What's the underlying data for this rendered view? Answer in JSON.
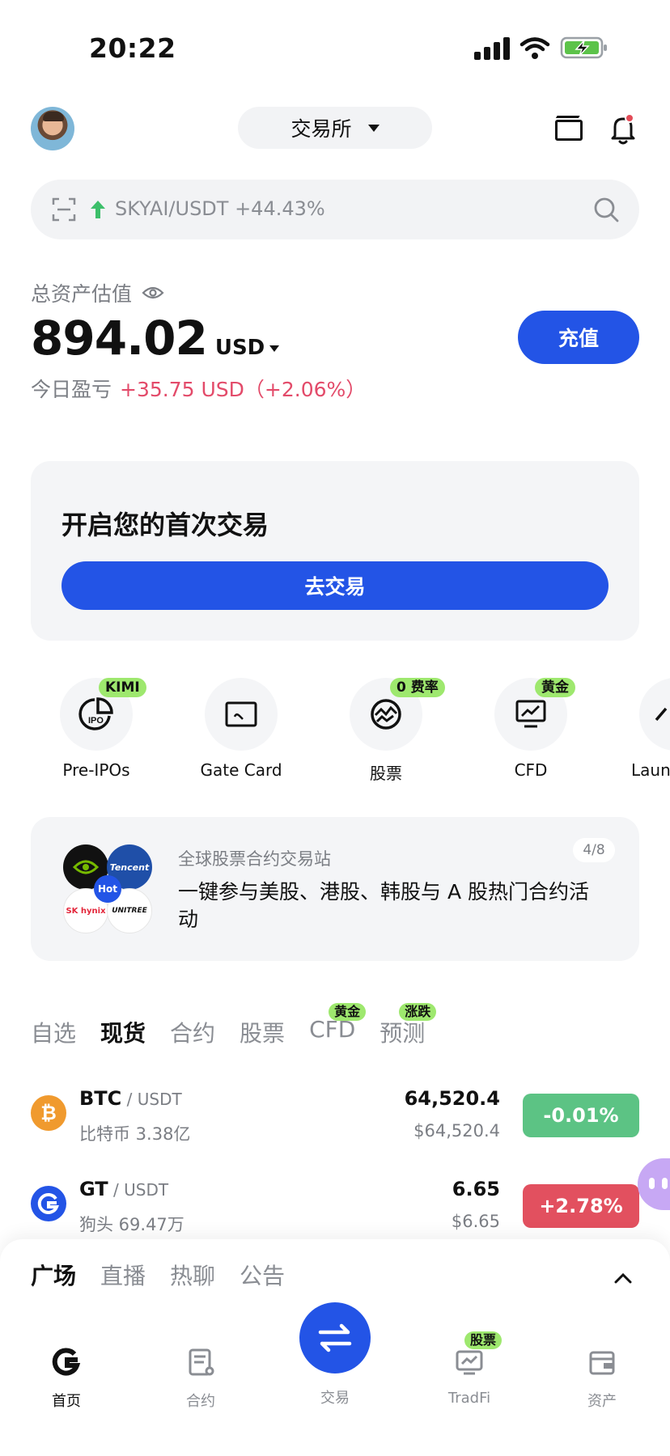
{
  "status_bar": {
    "time": "20:22"
  },
  "header": {
    "exchange_label": "交易所"
  },
  "search": {
    "trend_text": "SKYAI/USDT +44.43%"
  },
  "assets": {
    "label": "总资产估值",
    "value": "894.02",
    "currency": "USD",
    "deposit_label": "充值",
    "pnl_label": "今日盈亏",
    "pnl_value": "+35.75 USD（+2.06%）"
  },
  "first_trade": {
    "title": "开启您的首次交易",
    "button_label": "去交易"
  },
  "shortcuts": [
    {
      "label": "Pre-IPOs",
      "badge": "KIMI",
      "icon": "pre-ipo-icon"
    },
    {
      "label": "Gate Card",
      "badge": "",
      "icon": "card-icon"
    },
    {
      "label": "股票",
      "badge": "0 费率",
      "icon": "globe-stock-icon"
    },
    {
      "label": "CFD",
      "badge": "黄金",
      "icon": "chart-monitor-icon"
    },
    {
      "label": "Launc",
      "badge": "",
      "icon": "launch-icon"
    }
  ],
  "promo": {
    "kicker": "全球股票合约交易站",
    "title": "一键参与美股、港股、韩股与 A 股热门合约活动",
    "counter": "4/8",
    "logos": [
      "NVIDIA",
      "Tencent",
      "SK hynix",
      "UNITREE",
      "Hot"
    ]
  },
  "market_tabs": [
    {
      "label": "自选",
      "badge": ""
    },
    {
      "label": "现货",
      "badge": ""
    },
    {
      "label": "合约",
      "badge": ""
    },
    {
      "label": "股票",
      "badge": ""
    },
    {
      "label": "CFD",
      "badge": "黄金"
    },
    {
      "label": "预测",
      "badge": "涨跌"
    }
  ],
  "market_rows": [
    {
      "base": "BTC",
      "quote": " / USDT",
      "sub": "比特币 3.38亿",
      "price": "64,520.4",
      "price_usd": "$64,520.4",
      "change": "-0.01%",
      "change_color": "#5cc384",
      "icon_color": "#f09a2e",
      "icon_glyph": "₿"
    },
    {
      "base": "GT",
      "quote": " / USDT",
      "sub": "狗头 69.47万",
      "price": "6.65",
      "price_usd": "$6.65",
      "change": "+2.78%",
      "change_color": "#e2505f",
      "icon_color": "#2354e6",
      "icon_glyph": "G"
    }
  ],
  "community": {
    "tabs": [
      "广场",
      "直播",
      "热聊",
      "公告"
    ]
  },
  "bottom_nav": {
    "items": [
      "首页",
      "合约",
      "交易",
      "TradFi",
      "资产"
    ],
    "tradfi_badge": "股票"
  },
  "colors": {
    "accent": "#2354e6",
    "up": "#e34b6a",
    "badge": "#9ee86e"
  }
}
